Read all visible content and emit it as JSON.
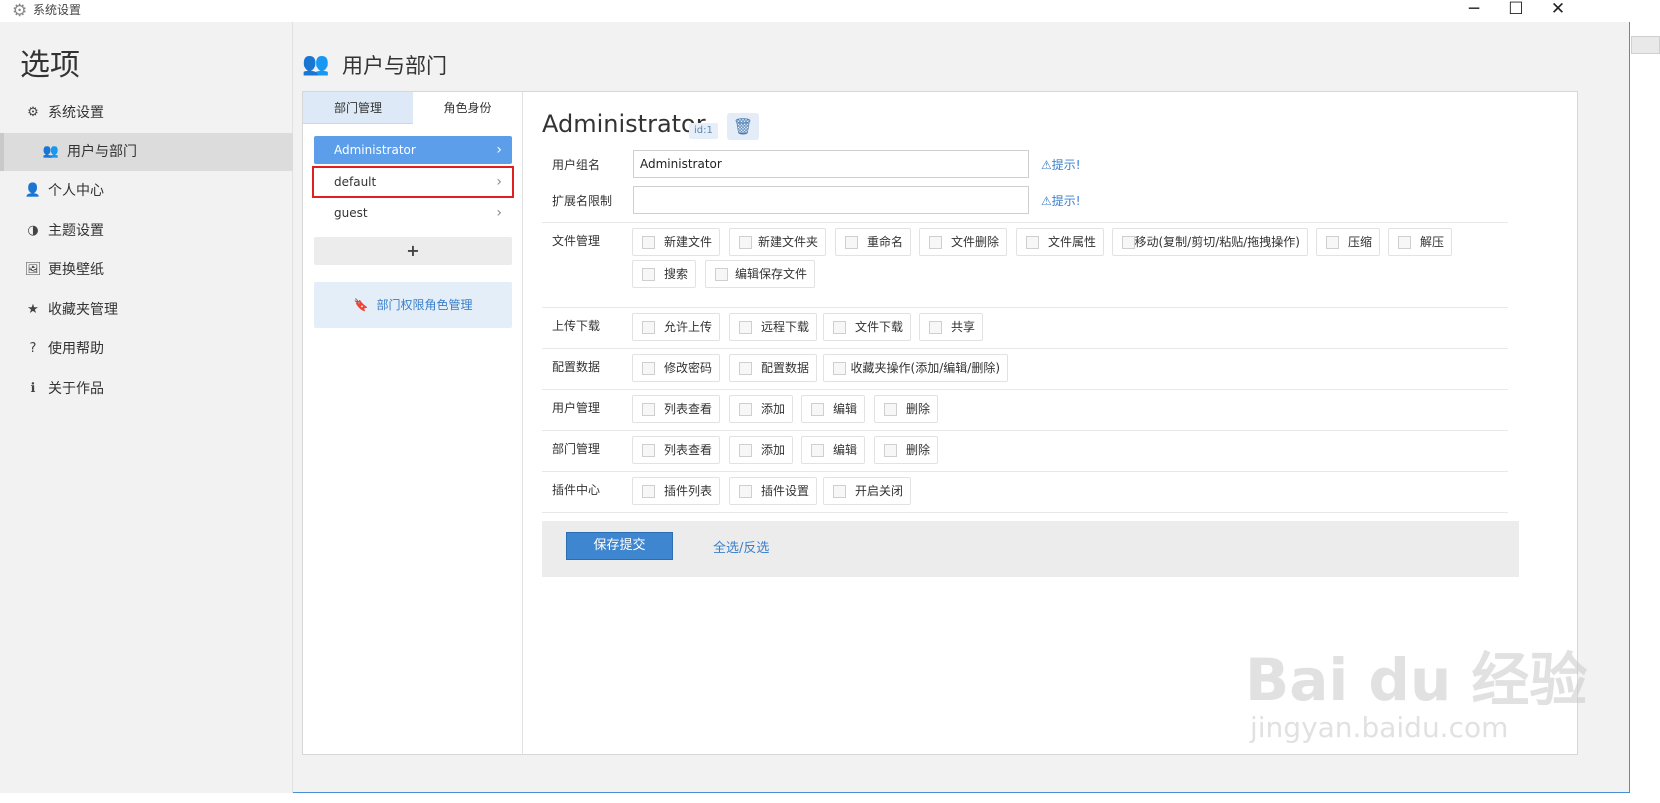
{
  "window": {
    "title": "系统设置",
    "controls": {
      "minimize": "─",
      "maximize": "☐",
      "close": "✕"
    }
  },
  "sidebar": {
    "heading": "选项",
    "items": [
      {
        "icon": "gear-icon",
        "glyph": "⚙",
        "label": "系统设置"
      },
      {
        "icon": "users-icon",
        "glyph": "👥",
        "label": "用户与部门"
      },
      {
        "icon": "user-icon",
        "glyph": "👤",
        "label": "个人中心"
      },
      {
        "icon": "palette-icon",
        "glyph": "◑",
        "label": "主题设置"
      },
      {
        "icon": "image-icon",
        "glyph": "🖼",
        "label": "更换壁纸"
      },
      {
        "icon": "star-icon",
        "glyph": "★",
        "label": "收藏夹管理"
      },
      {
        "icon": "question-icon",
        "glyph": "?",
        "label": "使用帮助"
      },
      {
        "icon": "info-icon",
        "glyph": "ℹ",
        "label": "关于作品"
      }
    ]
  },
  "main": {
    "title": "用户与部门",
    "title_glyph": "👥",
    "tabs": [
      {
        "label": "部门管理"
      },
      {
        "label": "角色身份"
      }
    ],
    "roles": [
      {
        "name": "Administrator",
        "chevron": "›"
      },
      {
        "name": "default",
        "chevron": "›"
      },
      {
        "name": "guest",
        "chevron": "›"
      }
    ],
    "add_label": "+",
    "dept_perm_label": "部门权限角色管理",
    "dept_perm_glyph": "🔖"
  },
  "detail": {
    "role_name": "Administrator",
    "id_badge": "id:1",
    "trash_glyph": "🗑",
    "group_name_label": "用户组名",
    "group_name_value": "Administrator",
    "ext_limit_label": "扩展名限制",
    "ext_limit_value": "",
    "hint_label": "提示!",
    "hint_glyph": "⚠",
    "permissions": [
      {
        "label": "文件管理",
        "options": [
          "新建文件",
          "新建文件夹",
          "重命名",
          "文件删除",
          "文件属性",
          "移动(复制/剪切/粘贴/拖拽操作)",
          "压缩",
          "解压",
          "搜索",
          "编辑保存文件"
        ]
      },
      {
        "label": "上传下载",
        "options": [
          "允许上传",
          "远程下载",
          "文件下载",
          "共享"
        ]
      },
      {
        "label": "配置数据",
        "options": [
          "修改密码",
          "配置数据",
          "收藏夹操作(添加/编辑/删除)"
        ]
      },
      {
        "label": "用户管理",
        "options": [
          "列表查看",
          "添加",
          "编辑",
          "删除"
        ]
      },
      {
        "label": "部门管理",
        "options": [
          "列表查看",
          "添加",
          "编辑",
          "删除"
        ]
      },
      {
        "label": "插件中心",
        "options": [
          "插件列表",
          "插件设置",
          "开启关闭"
        ]
      }
    ],
    "save_label": "保存提交",
    "select_all_label": "全选/反选"
  },
  "watermark": {
    "line1": "Bai du 经验",
    "line2": "jingyan.baidu.com"
  },
  "colors": {
    "accent": "#3f86d1",
    "selected_role": "#5c9ee9",
    "highlight": "#e02020"
  }
}
